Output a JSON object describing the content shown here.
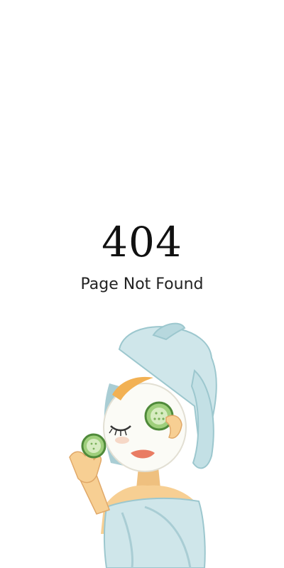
{
  "error": {
    "code": "404",
    "message": "Page Not Found"
  },
  "illustration": {
    "name": "spa-woman-with-cucumber-eye-mask"
  },
  "colors": {
    "background": "#ffffff",
    "text": "#111111",
    "towel": "#cfe6ea",
    "towel_shadow": "#a9cdd4",
    "skin": "#f7cf93",
    "mask": "#fbfbf6",
    "cucumber": "#9fcf7c"
  }
}
